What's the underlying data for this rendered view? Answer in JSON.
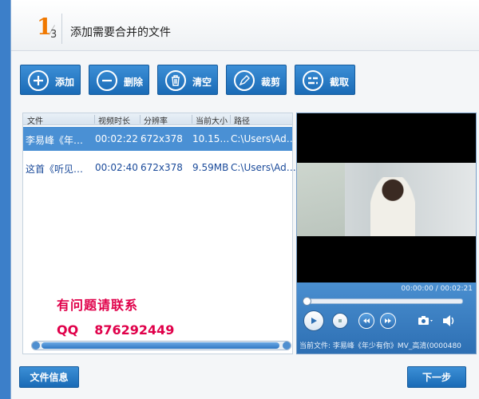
{
  "header": {
    "step_current": "1",
    "step_total": "3",
    "title": "添加需要合并的文件"
  },
  "toolbar": {
    "add": "添加",
    "delete": "删除",
    "clear": "清空",
    "trim": "裁剪",
    "capture": "截取"
  },
  "filelist": {
    "columns": [
      "文件",
      "视频时长",
      "分辨率",
      "当前大小",
      "路径"
    ],
    "rows": [
      {
        "name": "李易峰《年…",
        "duration": "00:02:22",
        "resolution": "672x378",
        "size": "10.15…",
        "path": "C:\\Users\\Ad…"
      },
      {
        "name": "这首《听见…",
        "duration": "00:02:40",
        "resolution": "672x378",
        "size": "9.59MB",
        "path": "C:\\Users\\Ad…"
      }
    ],
    "selected_row": 0,
    "overlay_line1": "有问题请联系",
    "overlay_qq_label": "QQ",
    "overlay_qq_number": "876292449"
  },
  "player": {
    "time": "00:00:00 / 00:02:21",
    "current_file": "当前文件: 李易峰《年少有你》MV_高清(0000480"
  },
  "footer": {
    "file_info": "文件信息",
    "next": "下一步"
  },
  "colors": {
    "accent": "#1a6bb6",
    "selection": "#4a90d4",
    "step_orange": "#f07800",
    "contact_red": "#e0004a"
  }
}
